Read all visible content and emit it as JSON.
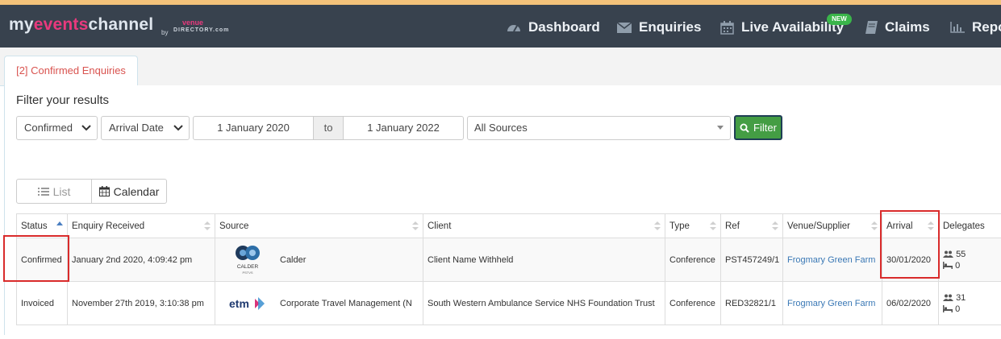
{
  "app": {
    "logo_prefix": "my",
    "logo_accent": "events",
    "logo_suffix": "channel",
    "logo_by": "by",
    "logo_venue": "venue",
    "logo_directory": "DIRECTORY.com",
    "brand_accent_color": "#e9397d"
  },
  "nav": {
    "items": [
      {
        "label": "Dashboard",
        "icon": "dashboard-icon"
      },
      {
        "label": "Enquiries",
        "icon": "envelope-icon"
      },
      {
        "label": "Live Availability",
        "icon": "calendar-icon",
        "badge": "NEW"
      },
      {
        "label": "Claims",
        "icon": "book-icon"
      },
      {
        "label": "Repo",
        "icon": "bar-chart-icon"
      }
    ]
  },
  "tabs": [
    {
      "label": "[2] Confirmed Enquiries",
      "active": true
    }
  ],
  "filter": {
    "title": "Filter your results",
    "status_value": "Confirmed",
    "date_field_value": "Arrival Date",
    "date_from": "1 January 2020",
    "to_label": "to",
    "date_to": "1 January 2022",
    "source_value": "All Sources",
    "button_label": "Filter"
  },
  "view_toggle": {
    "list_label": "List",
    "calendar_label": "Calendar"
  },
  "table": {
    "headers": {
      "status": "Status",
      "enquiry_received": "Enquiry Received",
      "source": "Source",
      "client": "Client",
      "type": "Type",
      "ref": "Ref",
      "venue": "Venue/Supplier",
      "arrival": "Arrival",
      "delegates": "Delegates"
    },
    "rows": [
      {
        "status": "Confirmed",
        "enquiry_received": "January 2nd 2020, 4:09:42 pm",
        "source_logo_text": "CALDER",
        "source_logo_sub": "PSTVS",
        "source": "Calder",
        "client": "Client Name Withheld",
        "type": "Conference",
        "ref": "PST457249/1",
        "venue": "Frogmary Green Farm",
        "arrival": "30/01/2020",
        "delegates": "55",
        "bedrooms": "0"
      },
      {
        "status": "Invoiced",
        "enquiry_received": "November 27th 2019, 3:10:38 pm",
        "source_logo_text": "etm",
        "source": "Corporate Travel Management (N",
        "client": "South Western Ambulance Service NHS Foundation Trust",
        "type": "Conference",
        "ref": "RED32821/1",
        "venue": "Frogmary Green Farm",
        "arrival": "06/02/2020",
        "delegates": "31",
        "bedrooms": "0"
      }
    ]
  }
}
